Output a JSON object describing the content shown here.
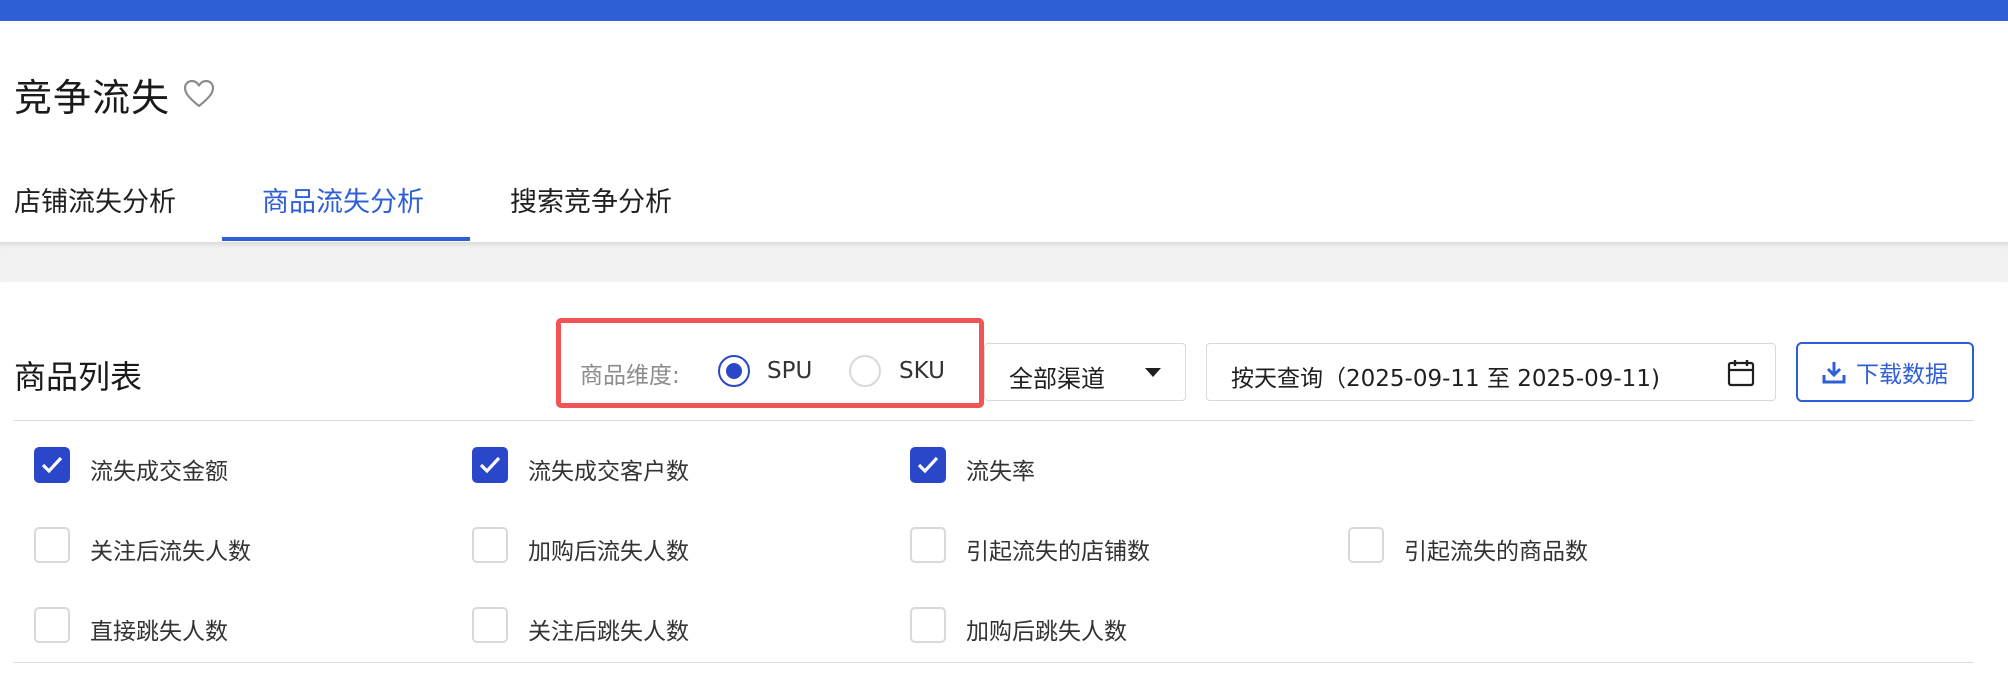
{
  "page": {
    "title": "竞争流失",
    "tabs": [
      {
        "label": "店铺流失分析",
        "active": false
      },
      {
        "label": "商品流失分析",
        "active": true
      },
      {
        "label": "搜索竞争分析",
        "active": false
      }
    ]
  },
  "section": {
    "title": "商品列表",
    "dimension_label": "商品维度:",
    "dimension_options": [
      {
        "label": "SPU",
        "selected": true
      },
      {
        "label": "SKU",
        "selected": false
      }
    ],
    "channel_select": "全部渠道",
    "date_range": "按天查询（2025-09-11 至 2025-09-11)",
    "download_label": "下载数据"
  },
  "metrics": [
    {
      "label": "流失成交金额",
      "checked": true
    },
    {
      "label": "流失成交客户数",
      "checked": true
    },
    {
      "label": "流失率",
      "checked": true
    },
    {
      "label": "关注后流失人数",
      "checked": false
    },
    {
      "label": "加购后流失人数",
      "checked": false
    },
    {
      "label": "引起流失的店铺数",
      "checked": false
    },
    {
      "label": "引起流失的商品数",
      "checked": false
    },
    {
      "label": "直接跳失人数",
      "checked": false
    },
    {
      "label": "关注后跳失人数",
      "checked": false
    },
    {
      "label": "加购后跳失人数",
      "checked": false
    }
  ],
  "colors": {
    "brand": "#2f5fd6",
    "checked": "#2b47c9",
    "highlight": "#f05454"
  }
}
